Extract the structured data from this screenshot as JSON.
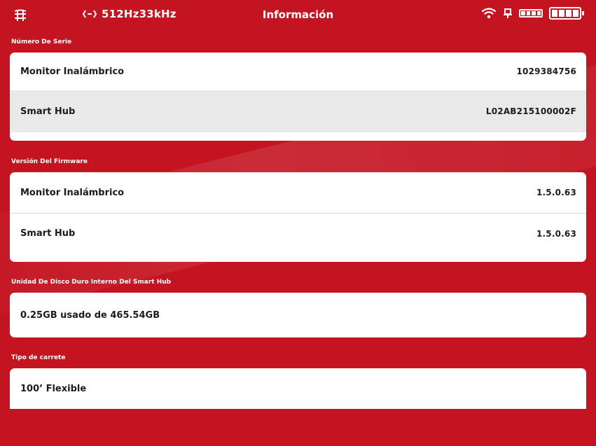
{
  "header": {
    "frequency": "512Hz33kHz",
    "title": "Información"
  },
  "colors": {
    "background": "#c41422",
    "card": "#ffffff",
    "shaded_row": "#e9e9e9",
    "text": "#1c1c1c"
  },
  "icons": {
    "left": "grid-icon",
    "frequency": "sonde-frequency-icon",
    "wifi": "wifi-icon",
    "pin": "pin-icon",
    "battery_small": "battery-small-icon",
    "battery_large": "battery-large-icon"
  },
  "serial": {
    "label": "Número De Serie",
    "rows": [
      {
        "name": "Monitor Inalámbrico",
        "value": "1029384756"
      },
      {
        "name": "Smart Hub",
        "value": "L02AB215100002F"
      }
    ]
  },
  "firmware": {
    "label": "Versión Del Firmware",
    "rows": [
      {
        "name": "Monitor Inalámbrico",
        "value": "1.5.0.63"
      },
      {
        "name": "Smart Hub",
        "value": "1.5.0.63"
      }
    ]
  },
  "disk": {
    "label": "Unidad De Disco Duro Interno Del Smart Hub",
    "usage": "0.25GB usado de 465.54GB"
  },
  "reel": {
    "label": "Tipo de carrete",
    "value": "100’ Flexible"
  }
}
